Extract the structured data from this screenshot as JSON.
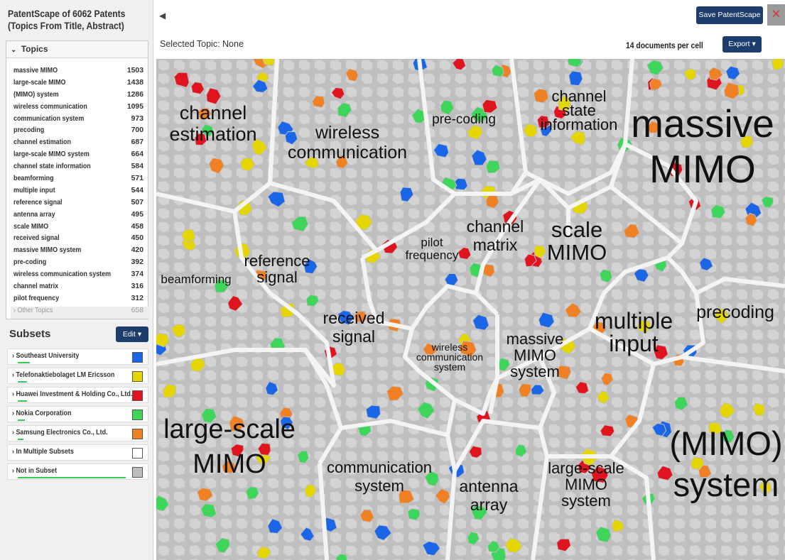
{
  "sidebar": {
    "title_line1": "PatentScape of 6062 Patents",
    "title_line2": "(Topics From Title, Abstract)",
    "topics_header": "Topics",
    "topics": [
      {
        "label": "massive MIMO",
        "count": "1503"
      },
      {
        "label": "large-scale MIMO",
        "count": "1438"
      },
      {
        "label": "(MIMO) system",
        "count": "1286"
      },
      {
        "label": "wireless communication",
        "count": "1095"
      },
      {
        "label": "communication system",
        "count": "973"
      },
      {
        "label": "precoding",
        "count": "700"
      },
      {
        "label": "channel estimation",
        "count": "687"
      },
      {
        "label": "large-scale MIMO system",
        "count": "664"
      },
      {
        "label": "channel state information",
        "count": "584"
      },
      {
        "label": "beamforming",
        "count": "571"
      },
      {
        "label": "multiple input",
        "count": "544"
      },
      {
        "label": "reference signal",
        "count": "507"
      },
      {
        "label": "antenna array",
        "count": "495"
      },
      {
        "label": "scale MIMO",
        "count": "458"
      },
      {
        "label": "received signal",
        "count": "450"
      },
      {
        "label": "massive MIMO system",
        "count": "420"
      },
      {
        "label": "pre-coding",
        "count": "392"
      },
      {
        "label": "wireless communication system",
        "count": "374"
      },
      {
        "label": "channel matrix",
        "count": "316"
      },
      {
        "label": "pilot frequency",
        "count": "312"
      }
    ],
    "other_topics": {
      "label": "Other Topics",
      "count": "658"
    },
    "subsets_title": "Subsets",
    "edit_label": "Edit",
    "subsets": [
      {
        "label": "Southeast University",
        "color": "#1a66e6",
        "bar_fraction": 0.09
      },
      {
        "label": "Telefonaktiebolaget LM Ericsson",
        "color": "#e6d600",
        "bar_fraction": 0.07
      },
      {
        "label": "Huawei Investment & Holding Co., Ltd.",
        "color": "#e0141e",
        "bar_fraction": 0.07
      },
      {
        "label": "Nokia Corporation",
        "color": "#3dd65a",
        "bar_fraction": 0.05
      },
      {
        "label": "Samsung Electronics Co., Ltd.",
        "color": "#f08024",
        "bar_fraction": 0.04
      },
      {
        "label": "In Multiple Subsets",
        "color": "#ffffff",
        "bar_fraction": 0
      },
      {
        "label": "Not in Subset",
        "color": "#bdbdbd",
        "bar_fraction": 0.8
      }
    ]
  },
  "main": {
    "selected_topic": "Selected Topic: None",
    "docs_per_cell": "14 documents per cell",
    "save_label": "Save PatentScape",
    "export_label": "Export",
    "close_icon": "close-x-icon",
    "collapse_icon": "triangle-left-icon"
  },
  "map": {
    "regions": [
      {
        "lines": [
          "channel",
          "estimation"
        ]
      },
      {
        "lines": [
          "wireless",
          "communication"
        ]
      },
      {
        "lines": [
          "pre-coding"
        ]
      },
      {
        "lines": [
          "channel",
          "state",
          "information"
        ]
      },
      {
        "lines": [
          "massive",
          "MIMO"
        ]
      },
      {
        "lines": [
          "beamforming"
        ]
      },
      {
        "lines": [
          "reference",
          "signal"
        ]
      },
      {
        "lines": [
          "pilot",
          "frequency"
        ]
      },
      {
        "lines": [
          "channel",
          "matrix"
        ]
      },
      {
        "lines": [
          "scale",
          "MIMO"
        ]
      },
      {
        "lines": [
          "precoding"
        ]
      },
      {
        "lines": [
          "received",
          "signal"
        ]
      },
      {
        "lines": [
          "wireless",
          "communication",
          "system"
        ]
      },
      {
        "lines": [
          "massive",
          "MIMO",
          "system"
        ]
      },
      {
        "lines": [
          "multiple",
          "input"
        ]
      },
      {
        "lines": [
          "large-scale",
          "MIMO"
        ]
      },
      {
        "lines": [
          "communication",
          "system"
        ]
      },
      {
        "lines": [
          "antenna",
          "array"
        ]
      },
      {
        "lines": [
          "large-scale",
          "MIMO",
          "system"
        ]
      },
      {
        "lines": [
          "(MIMO)",
          "system"
        ]
      }
    ]
  }
}
